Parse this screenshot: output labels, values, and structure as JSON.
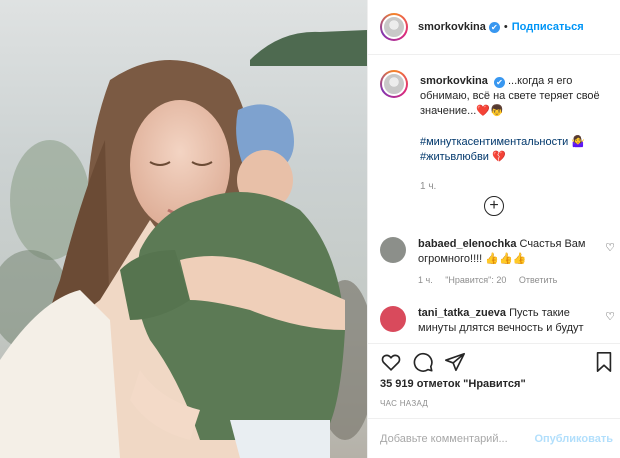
{
  "post": {
    "username": "smorkovkina",
    "follow_label": "Подписаться",
    "verified_glyph": "✔",
    "caption_text": "...когда я его обнимаю, всё на свете теряет своё значение...",
    "caption_emoji": "❤️👦",
    "hashtag1": "#минуткасентиментальности",
    "hashtag1_emoji": "🤷‍♀️",
    "hashtag2": "#житьвлюбви",
    "hashtag2_emoji": "💔",
    "caption_age": "1 ч.",
    "load_more_glyph": "+"
  },
  "comments": [
    {
      "username": "babaed_elenochka",
      "text": "Счастья Вам огромного!!!! 👍👍👍",
      "age": "1 ч.",
      "likes": "\"Нравится\": 20",
      "reply": "Ответить",
      "avatar_color": "#8c8f8a"
    },
    {
      "username": "tani_tatka_zueva",
      "text": "Пусть такие минуты длятся вечность и будут",
      "avatar_color": "#d94a5c"
    }
  ],
  "stats": {
    "likes_text": "35 919 отметок \"Нравится\"",
    "time_text": "ЧАС НАЗАД"
  },
  "input": {
    "placeholder": "Добавьте комментарий...",
    "publish_label": "Опубликовать"
  },
  "icons": [
    "heart-icon",
    "comment-icon",
    "share-icon",
    "bookmark-icon",
    "plus-circle-icon"
  ],
  "colors": {
    "accent": "#0095f6",
    "border": "#efefef",
    "muted": "#8e8e8e"
  }
}
